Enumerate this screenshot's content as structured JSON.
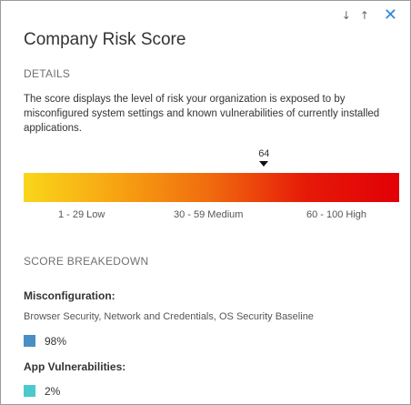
{
  "panel": {
    "title": "Company Risk Score",
    "actions": {
      "down_glyph": "↓",
      "up_glyph": "↑",
      "close_glyph": "✕"
    }
  },
  "details": {
    "heading": "DETAILS",
    "description": "The score displays the level of risk your organization is exposed to by misconfigured system settings and known vulnerabilities of currently installed applications."
  },
  "score": {
    "value": "64",
    "scale_max": 100,
    "ranges": [
      {
        "label": "1 - 29 Low"
      },
      {
        "label": "30 - 59 Medium"
      },
      {
        "label": "60 - 100 High"
      }
    ],
    "gradient_colors": [
      "#f9d61a",
      "#f7a312",
      "#f06a0e",
      "#e61a08",
      "#e10006"
    ]
  },
  "breakdown": {
    "heading": "SCORE BREAKEDOWN",
    "items": [
      {
        "title": "Misconfiguration:",
        "description": "Browser Security, Network and Credentials, OS Security Baseline",
        "percent": "98%",
        "color": "#4a8fc4"
      },
      {
        "title": "App Vulnerabilities:",
        "percent": "2%",
        "color": "#4cc9cc"
      }
    ]
  }
}
